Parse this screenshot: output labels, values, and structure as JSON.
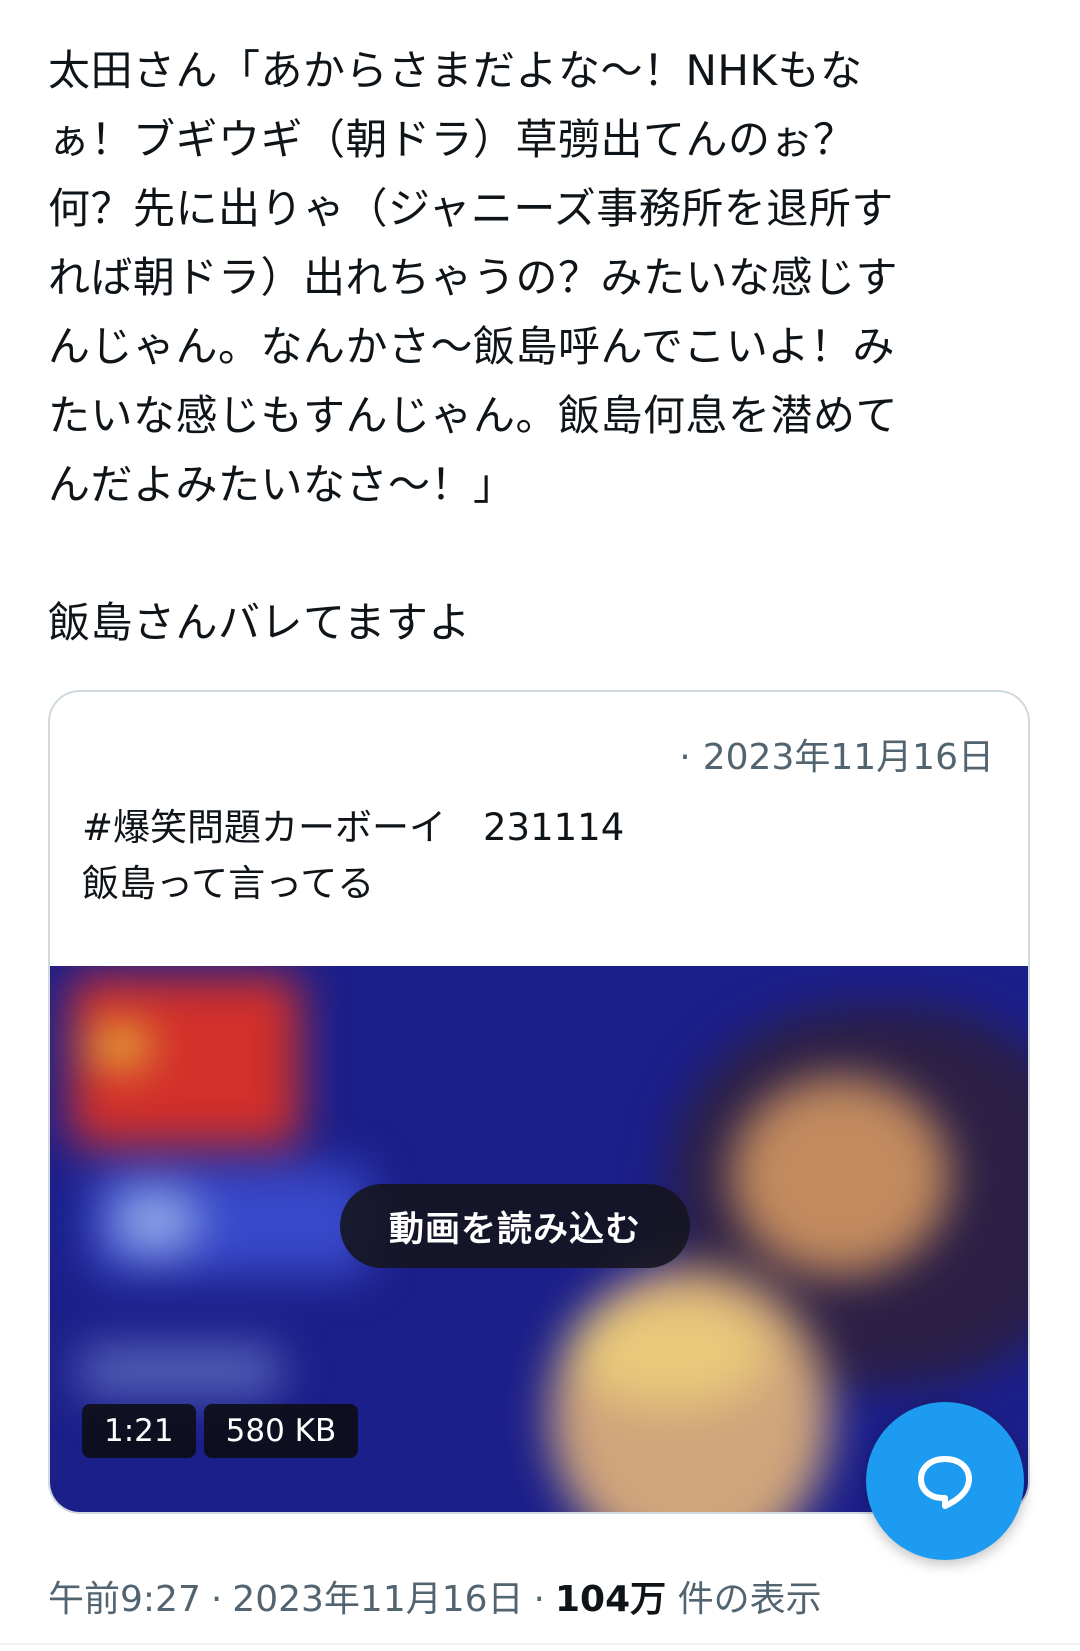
{
  "tweet": {
    "text_lines": [
      "太田さん「あからさまだよな〜！NHKもな",
      "ぁ！ブギウギ（朝ドラ）草彅出てんのぉ？",
      "何？先に出りゃ（ジャニーズ事務所を退所す",
      "れば朝ドラ）出れちゃうの？みたいな感じす",
      "んじゃん。なんかさ〜飯島呼んでこいよ！み",
      "たいな感じもすんじゃん。飯島何息を潜めて",
      "んだよみたいなさ〜！」"
    ],
    "text_last": "飯島さんバレてますよ",
    "time": "午前9:27",
    "date": "2023年11月16日",
    "views_count": "104万",
    "views_label": "件の表示"
  },
  "quote": {
    "date": "2023年11月16日",
    "body_lines": [
      "#爆笑問題カーボーイ　231114",
      "飯島って言ってる"
    ],
    "video": {
      "load_label": "動画を読み込む",
      "duration": "1:21",
      "size": "580 KB"
    }
  },
  "fab": {
    "icon": "reply-bubble-icon",
    "color": "#1d9bf0"
  },
  "colors": {
    "text": "#0f1419",
    "muted": "#536471",
    "border": "#cfd9de",
    "accent": "#1d9bf0"
  }
}
